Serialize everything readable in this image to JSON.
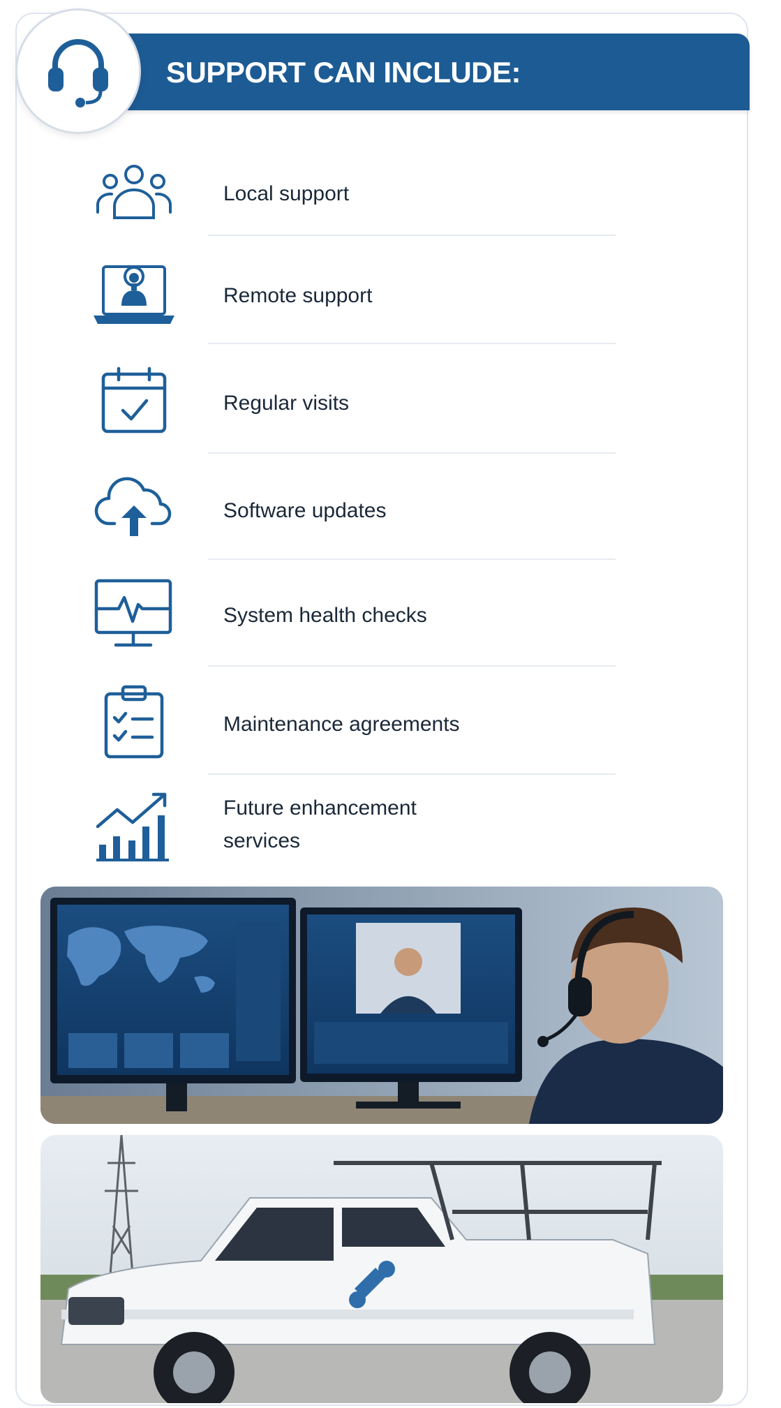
{
  "header": {
    "title": "SUPPORT CAN INCLUDE:",
    "icon": "headset-icon"
  },
  "items": [
    {
      "label": "Local support",
      "icon": "team-icon"
    },
    {
      "label": "Remote support",
      "icon": "laptop-agent-icon"
    },
    {
      "label": "Regular visits",
      "icon": "calendar-check-icon"
    },
    {
      "label": "Software updates",
      "icon": "cloud-upload-icon"
    },
    {
      "label": "System health checks",
      "icon": "monitor-pulse-icon"
    },
    {
      "label": "Maintenance agreements",
      "icon": "checklist-clipboard-icon"
    },
    {
      "label": "Future enhancement",
      "label2": "services",
      "icon": "growth-chart-icon"
    }
  ],
  "colors": {
    "brand_blue": "#1d5b94",
    "icon_blue": "#1e5f99",
    "text": "#1a2838",
    "divider": "#e6ebf1"
  }
}
